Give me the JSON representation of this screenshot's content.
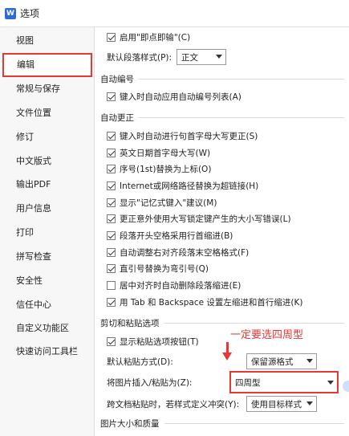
{
  "window": {
    "title": "选项",
    "icon_letter": "W"
  },
  "sidebar": {
    "items": [
      {
        "label": "视图"
      },
      {
        "label": "编辑",
        "active": true
      },
      {
        "label": "常规与保存"
      },
      {
        "label": "文件位置"
      },
      {
        "label": "修订"
      },
      {
        "label": "中文版式"
      },
      {
        "label": "输出PDF"
      },
      {
        "label": "用户信息"
      },
      {
        "label": "打印"
      },
      {
        "label": "拼写检查"
      },
      {
        "label": "安全性"
      },
      {
        "label": "信任中心"
      },
      {
        "label": "自定义功能区"
      },
      {
        "label": "快速访问工具栏"
      }
    ]
  },
  "top": {
    "click_type": {
      "label": "启用\"即点即输\"(C)",
      "checked": true
    },
    "para_style_label": "默认段落样式(P):",
    "para_style_value": "正文"
  },
  "auto_number": {
    "title": "自动编号",
    "items": [
      {
        "label": "键入时自动应用自动编号列表(A)",
        "checked": true
      }
    ]
  },
  "auto_correct": {
    "title": "自动更正",
    "items": [
      {
        "label": "键入时自动进行句首字母大写更正(S)",
        "checked": true
      },
      {
        "label": "英文日期首字母大写(W)",
        "checked": true
      },
      {
        "label": "序号(1st)替换为上标(O)",
        "checked": true
      },
      {
        "label": "Internet或网络路径替换为超链接(H)",
        "checked": true
      },
      {
        "label": "显示\"记忆式键入\"建议(M)",
        "checked": true
      },
      {
        "label": "更正意外使用大写锁定键产生的大小写错误(L)",
        "checked": true
      },
      {
        "label": "段落开头空格采用行首缩进(B)",
        "checked": true
      },
      {
        "label": "自动调整右对齐段落末空格格式(F)",
        "checked": true
      },
      {
        "label": "直引号替换为弯引号(Q)",
        "checked": true
      },
      {
        "label": "居中对齐时自动删除段落缩进(E)",
        "checked": false
      },
      {
        "label": "用 Tab 和 Backspace 设置左缩进和首行缩进(K)",
        "checked": true
      }
    ]
  },
  "cut_paste": {
    "title": "剪切和粘贴选项",
    "show_button": {
      "label": "显示粘贴选项按钮(T)",
      "checked": true
    },
    "default_paste_label": "默认粘贴方式(D):",
    "default_paste_value": "保留源格式",
    "image_paste_label": "将图片插入/粘贴为(Z):",
    "image_paste_value": "四周型",
    "cross_doc_label": "跨文档粘贴时，若样式定义冲突(Y):",
    "cross_doc_value": "使用目标样式"
  },
  "image_quality": {
    "title": "图片大小和质量"
  },
  "annotation": {
    "text": "一定要选四周型",
    "color": "#e53935"
  }
}
